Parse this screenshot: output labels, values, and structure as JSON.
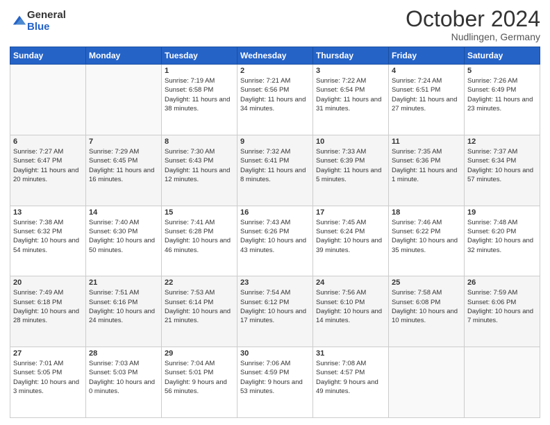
{
  "header": {
    "logo_general": "General",
    "logo_blue": "Blue",
    "month_title": "October 2024",
    "location": "Nudlingen, Germany"
  },
  "weekdays": [
    "Sunday",
    "Monday",
    "Tuesday",
    "Wednesday",
    "Thursday",
    "Friday",
    "Saturday"
  ],
  "weeks": [
    [
      {
        "day": "",
        "info": ""
      },
      {
        "day": "",
        "info": ""
      },
      {
        "day": "1",
        "info": "Sunrise: 7:19 AM\nSunset: 6:58 PM\nDaylight: 11 hours and 38 minutes."
      },
      {
        "day": "2",
        "info": "Sunrise: 7:21 AM\nSunset: 6:56 PM\nDaylight: 11 hours and 34 minutes."
      },
      {
        "day": "3",
        "info": "Sunrise: 7:22 AM\nSunset: 6:54 PM\nDaylight: 11 hours and 31 minutes."
      },
      {
        "day": "4",
        "info": "Sunrise: 7:24 AM\nSunset: 6:51 PM\nDaylight: 11 hours and 27 minutes."
      },
      {
        "day": "5",
        "info": "Sunrise: 7:26 AM\nSunset: 6:49 PM\nDaylight: 11 hours and 23 minutes."
      }
    ],
    [
      {
        "day": "6",
        "info": "Sunrise: 7:27 AM\nSunset: 6:47 PM\nDaylight: 11 hours and 20 minutes."
      },
      {
        "day": "7",
        "info": "Sunrise: 7:29 AM\nSunset: 6:45 PM\nDaylight: 11 hours and 16 minutes."
      },
      {
        "day": "8",
        "info": "Sunrise: 7:30 AM\nSunset: 6:43 PM\nDaylight: 11 hours and 12 minutes."
      },
      {
        "day": "9",
        "info": "Sunrise: 7:32 AM\nSunset: 6:41 PM\nDaylight: 11 hours and 8 minutes."
      },
      {
        "day": "10",
        "info": "Sunrise: 7:33 AM\nSunset: 6:39 PM\nDaylight: 11 hours and 5 minutes."
      },
      {
        "day": "11",
        "info": "Sunrise: 7:35 AM\nSunset: 6:36 PM\nDaylight: 11 hours and 1 minute."
      },
      {
        "day": "12",
        "info": "Sunrise: 7:37 AM\nSunset: 6:34 PM\nDaylight: 10 hours and 57 minutes."
      }
    ],
    [
      {
        "day": "13",
        "info": "Sunrise: 7:38 AM\nSunset: 6:32 PM\nDaylight: 10 hours and 54 minutes."
      },
      {
        "day": "14",
        "info": "Sunrise: 7:40 AM\nSunset: 6:30 PM\nDaylight: 10 hours and 50 minutes."
      },
      {
        "day": "15",
        "info": "Sunrise: 7:41 AM\nSunset: 6:28 PM\nDaylight: 10 hours and 46 minutes."
      },
      {
        "day": "16",
        "info": "Sunrise: 7:43 AM\nSunset: 6:26 PM\nDaylight: 10 hours and 43 minutes."
      },
      {
        "day": "17",
        "info": "Sunrise: 7:45 AM\nSunset: 6:24 PM\nDaylight: 10 hours and 39 minutes."
      },
      {
        "day": "18",
        "info": "Sunrise: 7:46 AM\nSunset: 6:22 PM\nDaylight: 10 hours and 35 minutes."
      },
      {
        "day": "19",
        "info": "Sunrise: 7:48 AM\nSunset: 6:20 PM\nDaylight: 10 hours and 32 minutes."
      }
    ],
    [
      {
        "day": "20",
        "info": "Sunrise: 7:49 AM\nSunset: 6:18 PM\nDaylight: 10 hours and 28 minutes."
      },
      {
        "day": "21",
        "info": "Sunrise: 7:51 AM\nSunset: 6:16 PM\nDaylight: 10 hours and 24 minutes."
      },
      {
        "day": "22",
        "info": "Sunrise: 7:53 AM\nSunset: 6:14 PM\nDaylight: 10 hours and 21 minutes."
      },
      {
        "day": "23",
        "info": "Sunrise: 7:54 AM\nSunset: 6:12 PM\nDaylight: 10 hours and 17 minutes."
      },
      {
        "day": "24",
        "info": "Sunrise: 7:56 AM\nSunset: 6:10 PM\nDaylight: 10 hours and 14 minutes."
      },
      {
        "day": "25",
        "info": "Sunrise: 7:58 AM\nSunset: 6:08 PM\nDaylight: 10 hours and 10 minutes."
      },
      {
        "day": "26",
        "info": "Sunrise: 7:59 AM\nSunset: 6:06 PM\nDaylight: 10 hours and 7 minutes."
      }
    ],
    [
      {
        "day": "27",
        "info": "Sunrise: 7:01 AM\nSunset: 5:05 PM\nDaylight: 10 hours and 3 minutes."
      },
      {
        "day": "28",
        "info": "Sunrise: 7:03 AM\nSunset: 5:03 PM\nDaylight: 10 hours and 0 minutes."
      },
      {
        "day": "29",
        "info": "Sunrise: 7:04 AM\nSunset: 5:01 PM\nDaylight: 9 hours and 56 minutes."
      },
      {
        "day": "30",
        "info": "Sunrise: 7:06 AM\nSunset: 4:59 PM\nDaylight: 9 hours and 53 minutes."
      },
      {
        "day": "31",
        "info": "Sunrise: 7:08 AM\nSunset: 4:57 PM\nDaylight: 9 hours and 49 minutes."
      },
      {
        "day": "",
        "info": ""
      },
      {
        "day": "",
        "info": ""
      }
    ]
  ]
}
